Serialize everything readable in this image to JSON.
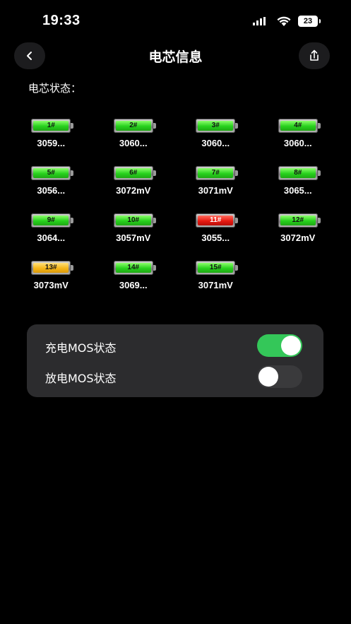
{
  "status_bar": {
    "time": "19:33",
    "battery": "23"
  },
  "nav": {
    "title": "电芯信息"
  },
  "section": {
    "label": "电芯状态："
  },
  "cells": [
    {
      "label": "1#",
      "voltage": "3059...",
      "status": "green"
    },
    {
      "label": "2#",
      "voltage": "3060...",
      "status": "green"
    },
    {
      "label": "3#",
      "voltage": "3060...",
      "status": "green"
    },
    {
      "label": "4#",
      "voltage": "3060...",
      "status": "green"
    },
    {
      "label": "5#",
      "voltage": "3056...",
      "status": "green"
    },
    {
      "label": "6#",
      "voltage": "3072mV",
      "status": "green"
    },
    {
      "label": "7#",
      "voltage": "3071mV",
      "status": "green"
    },
    {
      "label": "8#",
      "voltage": "3065...",
      "status": "green"
    },
    {
      "label": "9#",
      "voltage": "3064...",
      "status": "green"
    },
    {
      "label": "10#",
      "voltage": "3057mV",
      "status": "green"
    },
    {
      "label": "11#",
      "voltage": "3055...",
      "status": "red"
    },
    {
      "label": "12#",
      "voltage": "3072mV",
      "status": "green"
    },
    {
      "label": "13#",
      "voltage": "3073mV",
      "status": "yellow"
    },
    {
      "label": "14#",
      "voltage": "3069...",
      "status": "green"
    },
    {
      "label": "15#",
      "voltage": "3071mV",
      "status": "green"
    }
  ],
  "mos": {
    "charge_label": "充电MOS状态",
    "charge_on": true,
    "discharge_label": "放电MOS状态",
    "discharge_on": false
  },
  "colors": {
    "toggle_on": "#34c759",
    "card_bg": "#2c2c2e"
  }
}
